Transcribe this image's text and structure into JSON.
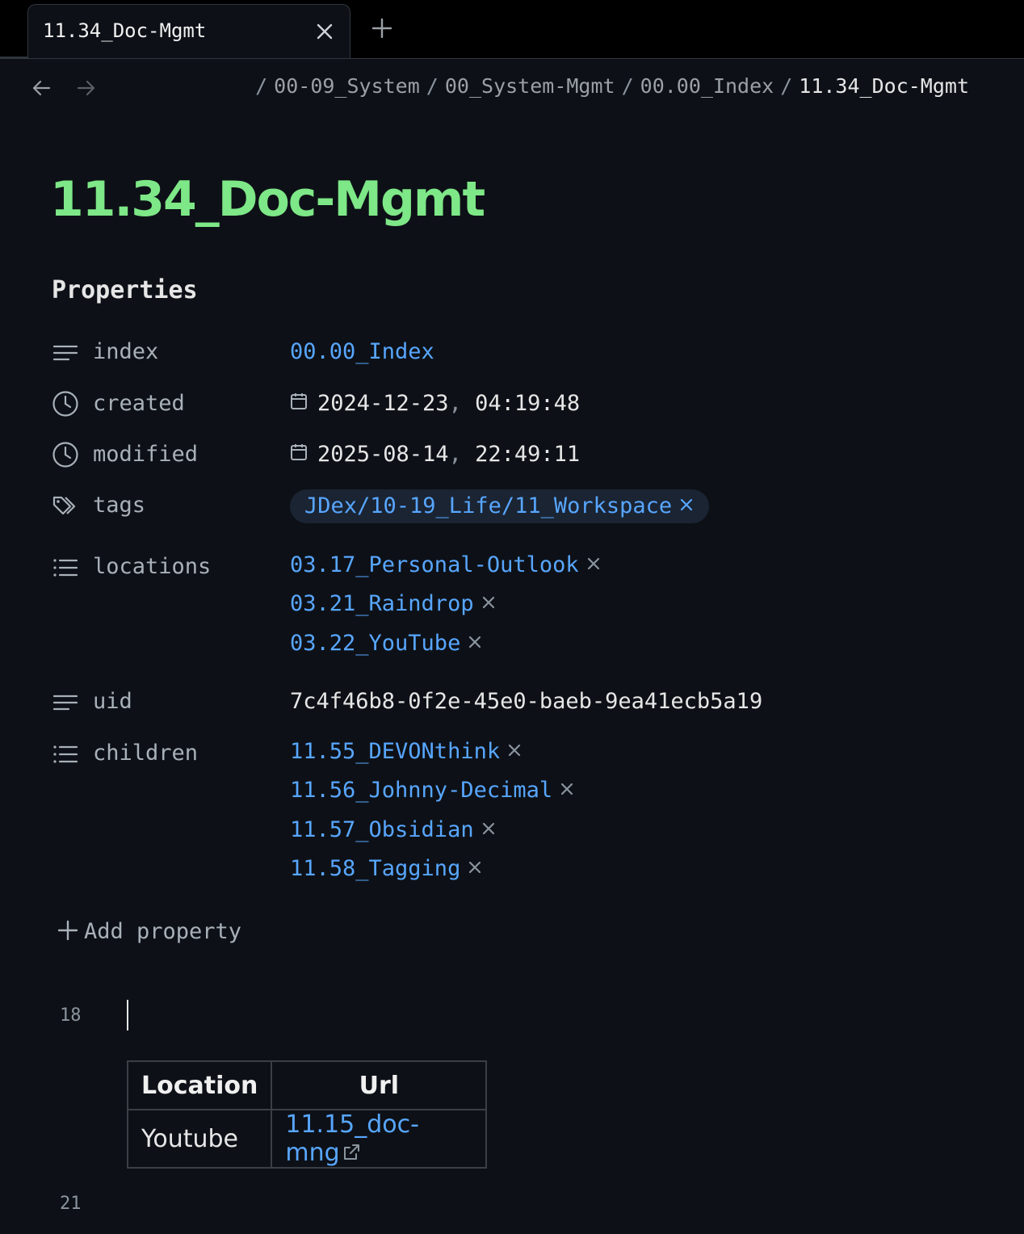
{
  "tab": {
    "title": "11.34_Doc-Mgmt"
  },
  "breadcrumb": {
    "items": [
      "00-09_System",
      "00_System-Mgmt",
      "00.00_Index"
    ],
    "current": "11.34_Doc-Mgmt",
    "separator": "/"
  },
  "page": {
    "title": "11.34_Doc-Mgmt"
  },
  "properties": {
    "heading": "Properties",
    "index": {
      "key": "index",
      "value": "00.00_Index"
    },
    "created": {
      "key": "created",
      "date": "2024-12-23",
      "time": "04:19:48"
    },
    "modified": {
      "key": "modified",
      "date": "2025-08-14",
      "time": "22:49:11"
    },
    "tags": {
      "key": "tags",
      "values": [
        "JDex/10-19_Life/11_Workspace"
      ]
    },
    "locations": {
      "key": "locations",
      "values": [
        "03.17_Personal-Outlook",
        "03.21_Raindrop",
        "03.22_YouTube"
      ]
    },
    "uid": {
      "key": "uid",
      "value": "7c4f46b8-0f2e-45e0-baeb-9ea41ecb5a19"
    },
    "children": {
      "key": "children",
      "values": [
        "11.55_DEVONthink",
        "11.56_Johnny-Decimal",
        "11.57_Obsidian",
        "11.58_Tagging"
      ]
    },
    "add_label": "Add property"
  },
  "editor": {
    "line_numbers": [
      "18",
      "21"
    ],
    "table": {
      "headers": [
        "Location",
        "Url"
      ],
      "rows": [
        {
          "location": "Youtube",
          "url": "11.15_doc-mng"
        }
      ]
    }
  },
  "colors": {
    "title": "#7ee787",
    "link": "#58a6ff",
    "background": "#0d1117"
  },
  "icons": [
    "close-icon",
    "plus-icon",
    "arrow-left-icon",
    "arrow-right-icon",
    "text-lines-icon",
    "clock-icon",
    "calendar-icon",
    "tag-icon",
    "list-icon",
    "external-link-icon"
  ]
}
